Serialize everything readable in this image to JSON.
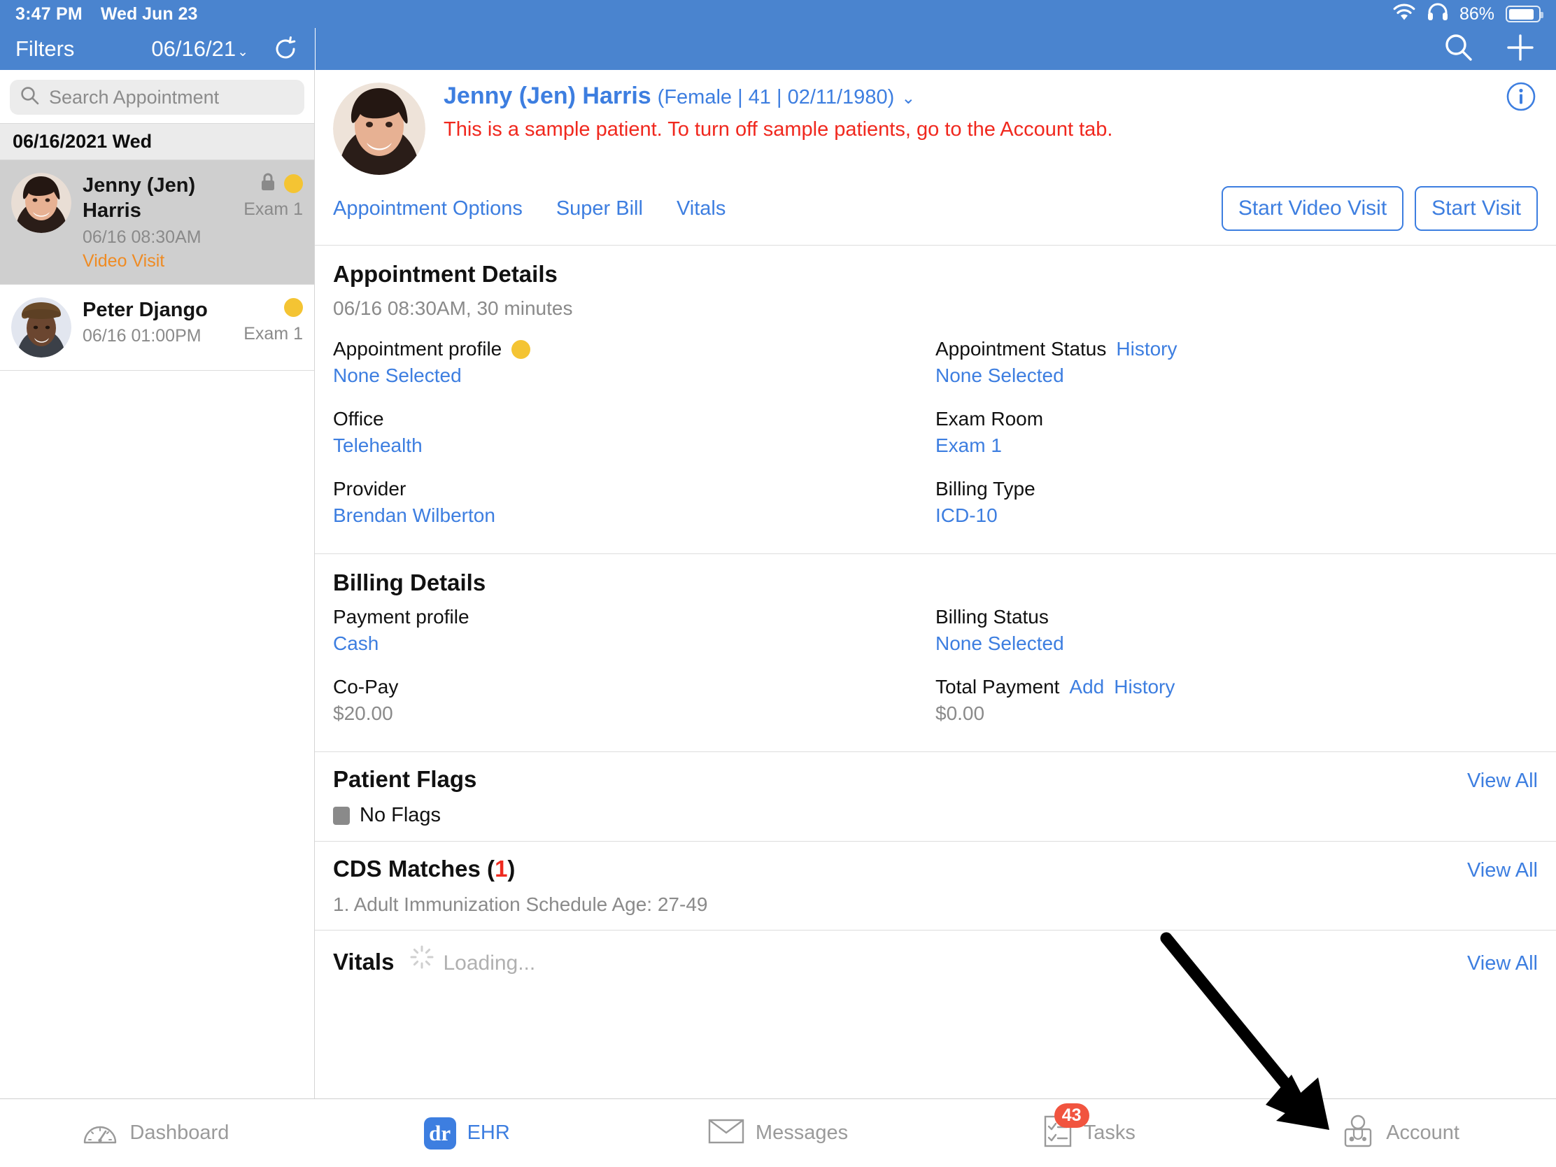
{
  "statusbar": {
    "time": "3:47 PM",
    "date": "Wed Jun 23",
    "battery_pct": "86%",
    "wifi_icon": "wifi-icon",
    "headphones_icon": "headphones-icon",
    "battery_icon": "battery-icon"
  },
  "header": {
    "filters_label": "Filters",
    "date_label": "06/16/21",
    "chevron": "⌄",
    "refresh_icon": "refresh-icon",
    "search_icon": "search-icon",
    "add_icon": "plus-icon",
    "bg_color": "#4a84cf"
  },
  "sidebar": {
    "search_placeholder": "Search Appointment",
    "search_value": "",
    "day_group_label": "06/16/2021 Wed",
    "appointments": [
      {
        "name": "Jenny (Jen) Harris",
        "time": "06/16 08:30AM",
        "tag": "Video Visit",
        "room": "Exam 1",
        "locked": true,
        "status_dot": "#f4c433",
        "selected": true
      },
      {
        "name": "Peter Django",
        "time": "06/16 01:00PM",
        "tag": "",
        "room": "Exam 1",
        "locked": false,
        "status_dot": "#f4c433",
        "selected": false
      }
    ]
  },
  "patient": {
    "name": "Jenny (Jen) Harris",
    "meta": "(Female | 41 | 02/11/1980)",
    "chevron": "⌄",
    "sample_notice": "This is a sample patient. To turn off sample patients, go to the Account tab.",
    "info_icon": "info-circle-icon",
    "links": [
      "Appointment Options",
      "Super Bill",
      "Vitals"
    ],
    "buttons": [
      "Start Video Visit",
      "Start Visit"
    ]
  },
  "appointment_details": {
    "title": "Appointment Details",
    "subtitle": "06/16 08:30AM, 30 minutes",
    "fields": [
      {
        "label": "Appointment profile",
        "value": "None Selected",
        "dot": "#f4c433",
        "link": ""
      },
      {
        "label": "Appointment Status",
        "value": "None Selected",
        "dot": "",
        "link": "History"
      },
      {
        "label": "Office",
        "value": "Telehealth",
        "dot": "",
        "link": ""
      },
      {
        "label": "Exam Room",
        "value": "Exam 1",
        "dot": "",
        "link": ""
      },
      {
        "label": "Provider",
        "value": "Brendan Wilberton",
        "dot": "",
        "link": ""
      },
      {
        "label": "Billing Type",
        "value": "ICD-10",
        "dot": "",
        "link": ""
      }
    ]
  },
  "billing_details": {
    "title": "Billing Details",
    "fields": [
      {
        "label": "Payment profile",
        "value": "Cash",
        "links": [],
        "gray": false
      },
      {
        "label": "Billing Status",
        "value": "None Selected",
        "links": [],
        "gray": false
      },
      {
        "label": "Co-Pay",
        "value": "$20.00",
        "links": [],
        "gray": true
      },
      {
        "label": "Total Payment",
        "value": "$0.00",
        "links": [
          "Add",
          "History"
        ],
        "gray": true
      }
    ]
  },
  "patient_flags": {
    "title": "Patient Flags",
    "view_all": "View All",
    "flag_text": "No Flags"
  },
  "cds_matches": {
    "title_prefix": "CDS Matches (",
    "count": "1",
    "title_suffix": ")",
    "view_all": "View All",
    "item": "1. Adult Immunization Schedule Age: 27-49"
  },
  "vitals": {
    "title": "Vitals",
    "loading_text": "Loading...",
    "view_all": "View All",
    "spinner_icon": "spinner-icon"
  },
  "tabbar": {
    "tabs": [
      {
        "label": "Dashboard",
        "icon": "gauge-icon",
        "active": false,
        "badge": ""
      },
      {
        "label": "EHR",
        "icon": "dr-logo-icon",
        "active": true,
        "badge": ""
      },
      {
        "label": "Messages",
        "icon": "envelope-icon",
        "active": false,
        "badge": ""
      },
      {
        "label": "Tasks",
        "icon": "checklist-icon",
        "active": false,
        "badge": "43"
      },
      {
        "label": "Account",
        "icon": "doctor-icon",
        "active": false,
        "badge": ""
      }
    ]
  },
  "annotation": {
    "arrow_icon": "pointer-arrow-icon"
  }
}
